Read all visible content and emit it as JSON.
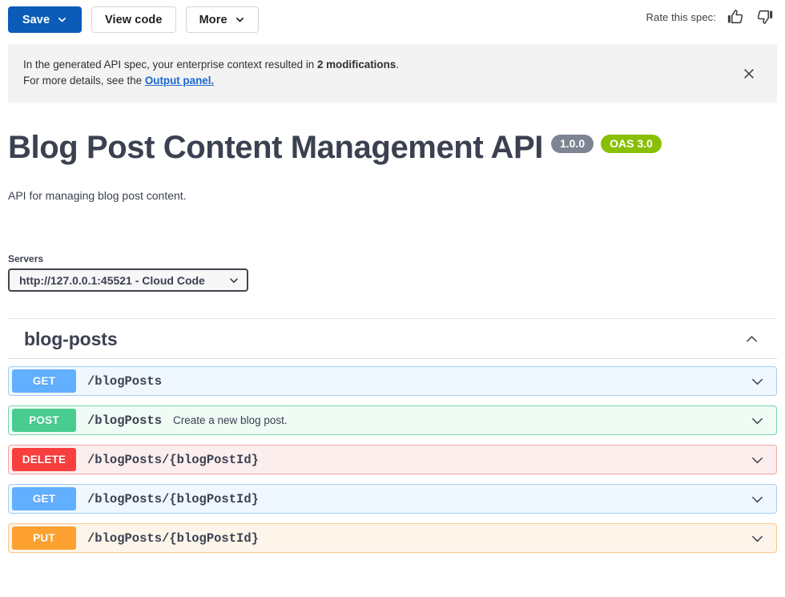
{
  "toolbar": {
    "save_label": "Save",
    "view_code_label": "View code",
    "more_label": "More",
    "rate_label": "Rate this spec:",
    "thumb_up_icon": "thumbs-up-icon",
    "thumb_down_icon": "thumbs-down-icon"
  },
  "banner": {
    "line1_prefix": "In the generated API spec, your enterprise context resulted in ",
    "line1_bold": "2 modifications",
    "line1_suffix": ".",
    "line2_prefix": "For more details, see the ",
    "line2_link": "Output panel.",
    "close_icon": "close-icon"
  },
  "info": {
    "title": "Blog Post Content Management API",
    "version_badge": "1.0.0",
    "oas_badge": "OAS 3.0",
    "description": "API for managing blog post content."
  },
  "servers": {
    "label": "Servers",
    "selected": "http://127.0.0.1:45521 - Cloud Code",
    "options": [
      "http://127.0.0.1:45521 - Cloud Code"
    ]
  },
  "tag": {
    "name": "blog-posts",
    "expanded": true,
    "toggle_icon": "chevron-up-icon"
  },
  "operations": [
    {
      "method": "GET",
      "method_class": "get",
      "path": "/blogPosts",
      "summary": "",
      "toggle_icon": "chevron-down-icon"
    },
    {
      "method": "POST",
      "method_class": "post",
      "path": "/blogPosts",
      "summary": "Create a new blog post.",
      "toggle_icon": "chevron-down-icon"
    },
    {
      "method": "DELETE",
      "method_class": "delete",
      "path": "/blogPosts/{blogPostId}",
      "summary": "",
      "toggle_icon": "chevron-down-icon"
    },
    {
      "method": "GET",
      "method_class": "get",
      "path": "/blogPosts/{blogPostId}",
      "summary": "",
      "toggle_icon": "chevron-down-icon"
    },
    {
      "method": "PUT",
      "method_class": "put",
      "path": "/blogPosts/{blogPostId}",
      "summary": "",
      "toggle_icon": "chevron-down-icon"
    }
  ],
  "colors": {
    "primary_button": "#0a5cb8",
    "link": "#1967d2",
    "get": "#61affe",
    "post": "#49cc90",
    "delete": "#f93e3e",
    "put": "#fca130",
    "version_badge": "#7d8492",
    "oas_badge": "#89bf04",
    "text": "#3b4151"
  }
}
